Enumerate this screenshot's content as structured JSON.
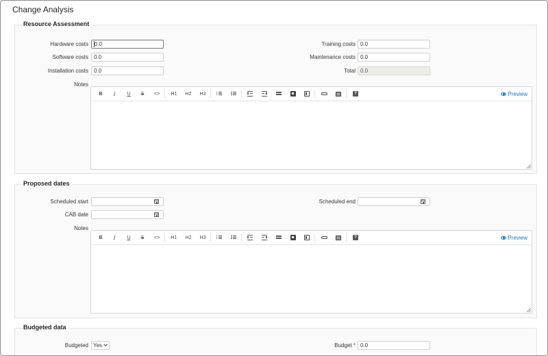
{
  "window": {
    "title": "Change Analysis"
  },
  "resource": {
    "heading": "Resource Assessment",
    "hardware_label": "Hardware costs",
    "hardware_value": "0.0",
    "software_label": "Software costs",
    "software_value": "0.0",
    "installation_label": "Installation costs",
    "installation_value": "0.0",
    "training_label": "Training costs",
    "training_value": "0.0",
    "maintenance_label": "Maintenance costs",
    "maintenance_value": "0.0",
    "total_label": "Total",
    "total_value": "0.0",
    "notes_label": "Notes"
  },
  "dates": {
    "heading": "Proposed dates",
    "start_label": "Scheduled start",
    "start_value": "",
    "end_label": "Scheduled end",
    "end_value": "",
    "cab_label": "CAB date",
    "cab_value": "",
    "notes_label": "Notes"
  },
  "budget": {
    "heading": "Budgeted data",
    "budgeted_label": "Budgeted",
    "budgeted_value": "Yes",
    "budget_label": "Budget",
    "budget_required": "*",
    "budget_value": "0.0"
  },
  "editor": {
    "bold": "B",
    "italic": "I",
    "underline": "U",
    "strike": "S",
    "code": "<>",
    "h1": "H1",
    "h2": "H2",
    "h3": "H3",
    "preview_label": "Preview"
  },
  "icons": [
    "calendar-icon",
    "eye-icon",
    "link-icon",
    "image-icon",
    "help-icon",
    "chevron-down-icon"
  ]
}
